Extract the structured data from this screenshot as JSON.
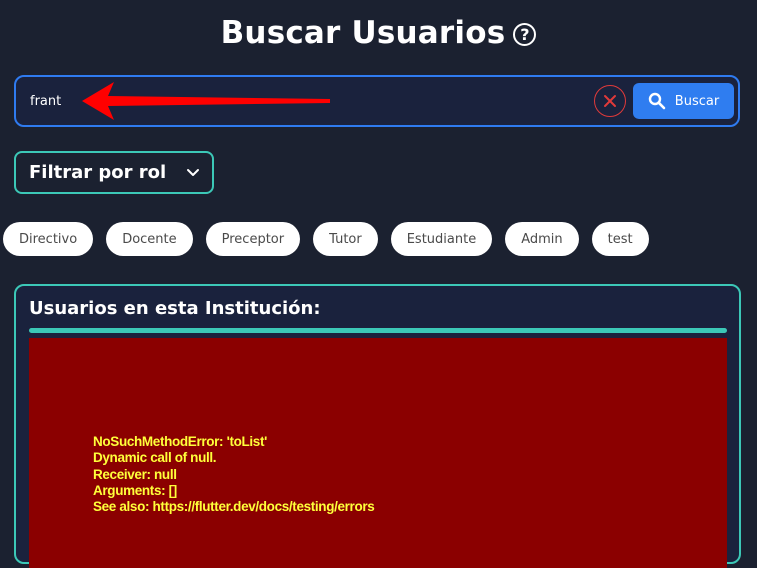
{
  "header": {
    "title": "Buscar Usuarios",
    "help_icon": "help-circle-icon"
  },
  "search": {
    "value": "frant",
    "clear_icon": "close-icon",
    "button_label": "Buscar",
    "button_icon": "search-icon"
  },
  "filter": {
    "label": "Filtrar por rol",
    "icon": "chevron-down-icon"
  },
  "roles": [
    "Directivo",
    "Docente",
    "Preceptor",
    "Tutor",
    "Estudiante",
    "Admin",
    "test"
  ],
  "results": {
    "title": "Usuarios en esta Institución:",
    "error_lines": [
      "NoSuchMethodError: 'toList'",
      "Dynamic call of null.",
      "Receiver: null",
      "Arguments: []",
      "See also: https://flutter.dev/docs/testing/errors"
    ]
  },
  "colors": {
    "background": "#1b2130",
    "accent_blue": "#2f7df0",
    "accent_teal": "#3cc8b7",
    "error_bg": "#8b0000",
    "error_text": "#ffff3a",
    "annotation_arrow": "#ff0000"
  }
}
